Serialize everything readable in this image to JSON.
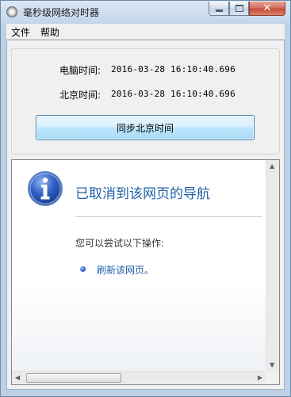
{
  "window": {
    "title": "毫秒级网络对时器"
  },
  "menu": {
    "items": [
      {
        "label": "文件"
      },
      {
        "label": "帮助"
      }
    ]
  },
  "times": {
    "computer_label": "电脑时间:",
    "computer_value": "2016-03-28 16:10:40.696",
    "beijing_label": "北京时间:",
    "beijing_value": "2016-03-28 16:10:40.696"
  },
  "sync_button": {
    "label": "同步北京时间"
  },
  "browser": {
    "heading": "已取消到该网页的导航",
    "suggestion": "您可以尝试以下操作:",
    "refresh_link": "刷新该网页。"
  },
  "icons": {
    "info": "info-icon",
    "app": "app-icon"
  },
  "colors": {
    "link": "#1f5fa8",
    "close_button": "#c24a33",
    "button_border": "#3c7fb1"
  }
}
